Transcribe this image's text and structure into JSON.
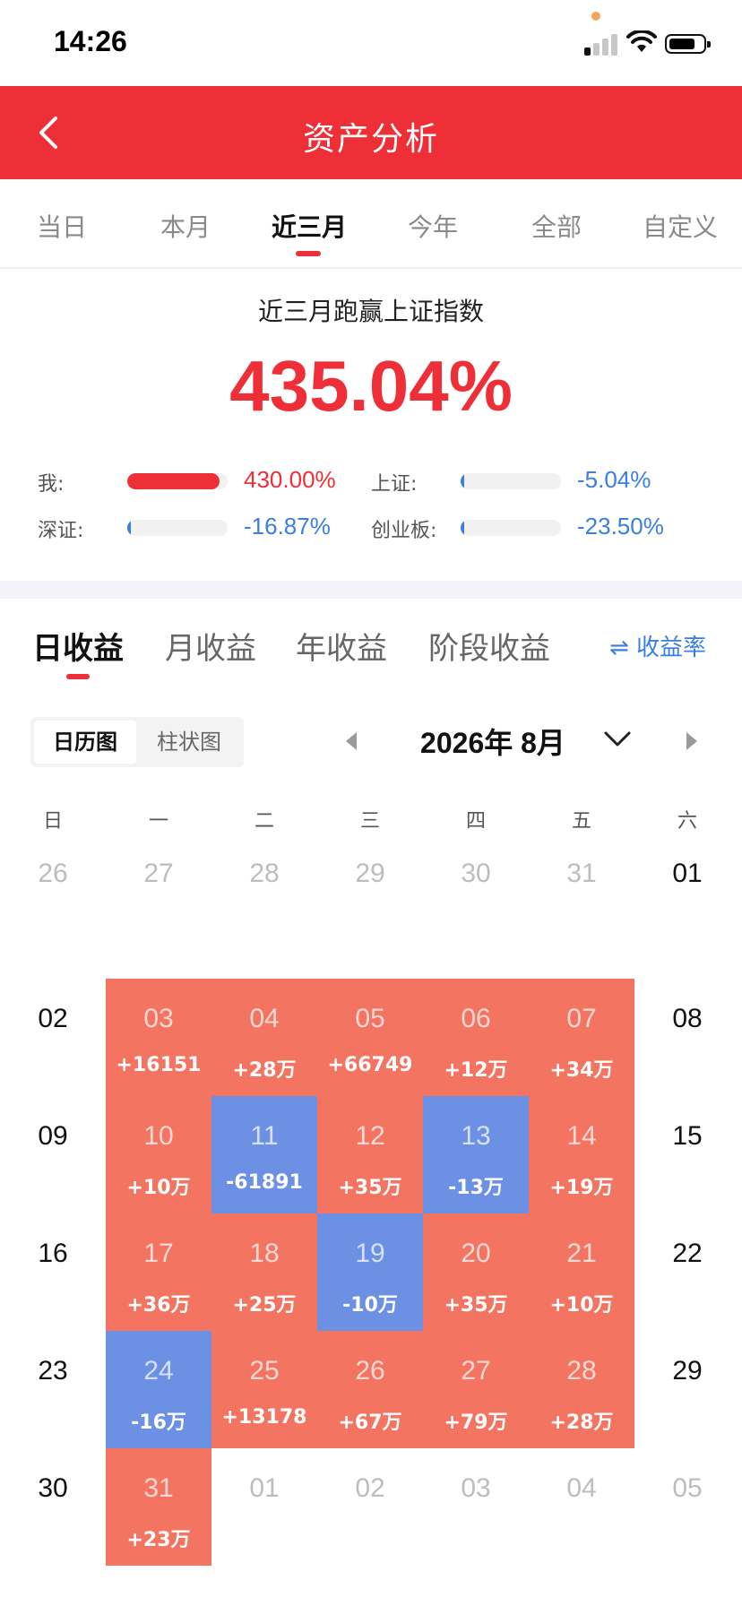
{
  "status_bar": {
    "time": "14:26"
  },
  "header": {
    "title": "资产分析"
  },
  "period_tabs": [
    {
      "label": "当日",
      "active": false
    },
    {
      "label": "本月",
      "active": false
    },
    {
      "label": "近三月",
      "active": true
    },
    {
      "label": "今年",
      "active": false
    },
    {
      "label": "全部",
      "active": false
    },
    {
      "label": "自定义",
      "active": false
    }
  ],
  "summary": {
    "title": "近三月跑赢上证指数",
    "percent": "435.04%",
    "comparisons": [
      {
        "label": "我:",
        "value": "430.00%",
        "fill": 0.92,
        "color": "#ee2f37"
      },
      {
        "label": "上证:",
        "value": "-5.04%",
        "fill": 0.02,
        "color": "#3a7ee0"
      },
      {
        "label": "深证:",
        "value": "-16.87%",
        "fill": 0.02,
        "color": "#3a7ee0"
      },
      {
        "label": "创业板:",
        "value": "-23.50%",
        "fill": 0.03,
        "color": "#3a7ee0"
      }
    ]
  },
  "income_tabs": [
    {
      "label": "日收益",
      "active": true
    },
    {
      "label": "月收益",
      "active": false
    },
    {
      "label": "年收益",
      "active": false
    },
    {
      "label": "阶段收益",
      "active": false
    }
  ],
  "rate_switch": {
    "icon": "swap-icon",
    "label": "⇌ 收益率"
  },
  "view_toggle": {
    "calendar": "日历图",
    "bar": "柱状图",
    "active": "calendar"
  },
  "month": {
    "label": "2026年 8月"
  },
  "weekdays": [
    "日",
    "一",
    "二",
    "三",
    "四",
    "五",
    "六"
  ],
  "calendar": [
    [
      {
        "day": "26",
        "type": "other"
      },
      {
        "day": "27",
        "type": "other"
      },
      {
        "day": "28",
        "type": "other"
      },
      {
        "day": "29",
        "type": "other"
      },
      {
        "day": "30",
        "type": "other"
      },
      {
        "day": "31",
        "type": "other"
      },
      {
        "day": "01",
        "type": "plain"
      }
    ],
    [
      {
        "day": "02",
        "type": "plain"
      },
      {
        "day": "03",
        "type": "pos",
        "amount": "+16151"
      },
      {
        "day": "04",
        "type": "pos",
        "amount": "+28万"
      },
      {
        "day": "05",
        "type": "pos",
        "amount": "+66749"
      },
      {
        "day": "06",
        "type": "pos",
        "amount": "+12万"
      },
      {
        "day": "07",
        "type": "pos",
        "amount": "+34万"
      },
      {
        "day": "08",
        "type": "plain"
      }
    ],
    [
      {
        "day": "09",
        "type": "plain"
      },
      {
        "day": "10",
        "type": "pos",
        "amount": "+10万"
      },
      {
        "day": "11",
        "type": "neg",
        "amount": "-61891"
      },
      {
        "day": "12",
        "type": "pos",
        "amount": "+35万"
      },
      {
        "day": "13",
        "type": "neg",
        "amount": "-13万"
      },
      {
        "day": "14",
        "type": "pos",
        "amount": "+19万"
      },
      {
        "day": "15",
        "type": "plain"
      }
    ],
    [
      {
        "day": "16",
        "type": "plain"
      },
      {
        "day": "17",
        "type": "pos",
        "amount": "+36万"
      },
      {
        "day": "18",
        "type": "pos",
        "amount": "+25万"
      },
      {
        "day": "19",
        "type": "neg",
        "amount": "-10万"
      },
      {
        "day": "20",
        "type": "pos",
        "amount": "+35万"
      },
      {
        "day": "21",
        "type": "pos",
        "amount": "+10万"
      },
      {
        "day": "22",
        "type": "plain"
      }
    ],
    [
      {
        "day": "23",
        "type": "plain"
      },
      {
        "day": "24",
        "type": "neg",
        "amount": "-16万"
      },
      {
        "day": "25",
        "type": "pos",
        "amount": "+13178"
      },
      {
        "day": "26",
        "type": "pos",
        "amount": "+67万"
      },
      {
        "day": "27",
        "type": "pos",
        "amount": "+79万"
      },
      {
        "day": "28",
        "type": "pos",
        "amount": "+28万"
      },
      {
        "day": "29",
        "type": "plain"
      }
    ],
    [
      {
        "day": "30",
        "type": "plain"
      },
      {
        "day": "31",
        "type": "pos",
        "amount": "+23万"
      },
      {
        "day": "01",
        "type": "other"
      },
      {
        "day": "02",
        "type": "other"
      },
      {
        "day": "03",
        "type": "other"
      },
      {
        "day": "04",
        "type": "other"
      },
      {
        "day": "05",
        "type": "other"
      }
    ]
  ],
  "colors": {
    "brand_red": "#ee2f37",
    "gain": "#f47462",
    "loss": "#6c90e4",
    "link_blue": "#3a7ee0"
  }
}
